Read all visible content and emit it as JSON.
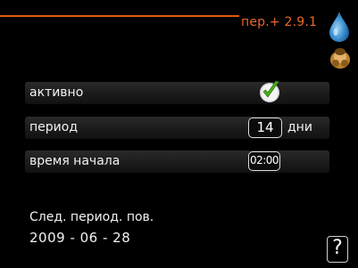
{
  "header": {
    "menu_code": "пер.+ 2.9.1",
    "menu_icon": "water-drop-icon",
    "user_icon": "person-icon",
    "accent_color": "#d95a12"
  },
  "settings": {
    "active": {
      "label": "активно",
      "checked": true,
      "icon": "checkmark-icon"
    },
    "period": {
      "label": "период",
      "value": "14",
      "unit": "дни"
    },
    "start_time": {
      "label": "время начала",
      "value": "02:00"
    }
  },
  "next_period": {
    "label": "След. период. пов.",
    "date": "2009 - 06 - 28"
  },
  "help": {
    "label": "?"
  }
}
